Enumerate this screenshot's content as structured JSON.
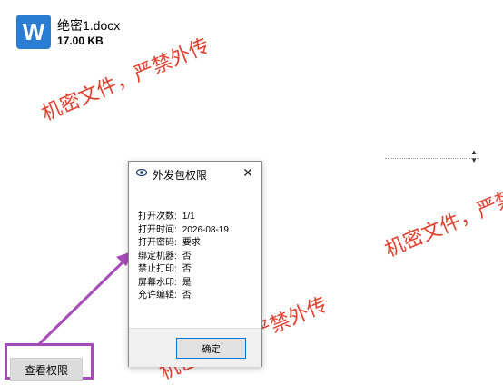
{
  "file": {
    "icon_letter": "W",
    "name": "绝密1.docx",
    "size": "17.00 KB"
  },
  "watermark_text": "机密文件，严禁外传",
  "dialog": {
    "title": "外发包权限",
    "close_glyph": "✕",
    "fields": [
      {
        "key": "打开次数:",
        "value": "1/1"
      },
      {
        "key": "打开时间:",
        "value": "2026-08-19"
      },
      {
        "key": "打开密码:",
        "value": "要求"
      },
      {
        "key": "绑定机器:",
        "value": "否"
      },
      {
        "key": "禁止打印:",
        "value": "否"
      },
      {
        "key": "屏幕水印:",
        "value": "是"
      },
      {
        "key": "允许编辑:",
        "value": "否"
      }
    ],
    "ok_label": "确定"
  },
  "view_permissions_label": "查看权限",
  "colors": {
    "word_blue": "#2b7cd3",
    "watermark_red": "#e0301e",
    "highlight_purple": "#a64bb8"
  }
}
